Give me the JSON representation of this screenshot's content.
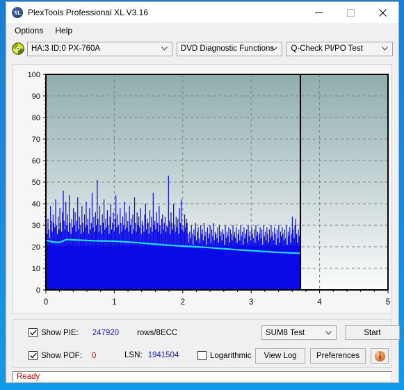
{
  "window": {
    "title": "PlexTools Professional XL V3.16",
    "icon_label": "XL",
    "minimize_label": "Minimize",
    "maximize_label": "Maximize",
    "close_label": "Close"
  },
  "menubar": {
    "items": [
      {
        "label": "Options"
      },
      {
        "label": "Help"
      }
    ]
  },
  "toolbar": {
    "drive": {
      "value": "HA:3 ID:0  PX-760A"
    },
    "function": {
      "value": "DVD Diagnostic Functions"
    },
    "test": {
      "value": "Q-Check PI/PO Test"
    }
  },
  "controls": {
    "show_pie": {
      "label": "Show PIE:",
      "checked": true,
      "value": "247920",
      "unit": "rows/8ECC"
    },
    "show_pof": {
      "label": "Show POF:",
      "checked": true,
      "value": "0"
    },
    "lsn": {
      "label": "LSN:",
      "value": "1941504"
    },
    "logarithmic": {
      "label": "Logarithmic",
      "checked": false
    },
    "test_select": {
      "value": "SUM8 Test"
    },
    "start_button": {
      "label": "Start"
    },
    "view_log_button": {
      "label": "View Log"
    },
    "preferences_button": {
      "label": "Preferences"
    },
    "info_button": {
      "label": "i"
    }
  },
  "statusbar": {
    "text": "Ready"
  },
  "chart_data": {
    "type": "area",
    "title": "",
    "xlabel": "",
    "ylabel": "",
    "xlim": [
      0,
      5
    ],
    "ylim": [
      0,
      100
    ],
    "xticks": [
      0,
      1,
      2,
      3,
      4,
      5
    ],
    "yticks": [
      0,
      10,
      20,
      30,
      40,
      50,
      60,
      70,
      80,
      90,
      100
    ],
    "grid": true,
    "legend": "none",
    "colors": {
      "pie_bars": "#0a0ae6",
      "average_line": "#1ce0f0",
      "plot_top": "#8fadae",
      "plot_bottom": "#fbfcfc",
      "axis": "#000000",
      "gridline": "#808080",
      "data_end_marker": "#000000"
    },
    "data_end_x": 3.72,
    "series": [
      {
        "name": "PIE",
        "type": "bar",
        "note": "Per-sample PI error peaks across the disc; dense spiky blue fill from x=0 to x=3.72",
        "x_start": 0,
        "x_end": 3.72,
        "n_samples": 300,
        "values": [
          30,
          26,
          33,
          28,
          24,
          39,
          32,
          27,
          35,
          31,
          29,
          42,
          30,
          26,
          34,
          28,
          38,
          31,
          27,
          36,
          46,
          32,
          28,
          41,
          30,
          35,
          27,
          44,
          31,
          26,
          33,
          29,
          38,
          30,
          36,
          27,
          32,
          43,
          28,
          34,
          30,
          26,
          39,
          31,
          27,
          35,
          29,
          41,
          30,
          33,
          26,
          38,
          28,
          31,
          45,
          29,
          34,
          27,
          36,
          30,
          51,
          33,
          27,
          39,
          30,
          26,
          35,
          31,
          42,
          28,
          33,
          29,
          37,
          30,
          26,
          34,
          40,
          28,
          31,
          36,
          27,
          33,
          44,
          29,
          35,
          30,
          26,
          38,
          31,
          27,
          34,
          30,
          41,
          28,
          36,
          29,
          32,
          27,
          39,
          30,
          33,
          26,
          35,
          28,
          43,
          31,
          27,
          36,
          30,
          34,
          29,
          38,
          26,
          32,
          30,
          27,
          35,
          40,
          28,
          33,
          31,
          26,
          37,
          29,
          34,
          27,
          45,
          30,
          32,
          28,
          36,
          31,
          27,
          39,
          30,
          26,
          33,
          35,
          28,
          31,
          34,
          27,
          30,
          29,
          53,
          32,
          26,
          36,
          31,
          28,
          40,
          30,
          27,
          34,
          29,
          33,
          26,
          38,
          31,
          42,
          28,
          30,
          27,
          35,
          29,
          33,
          31,
          26,
          22,
          27,
          24,
          30,
          26,
          21,
          28,
          25,
          31,
          23,
          27,
          29,
          24,
          22,
          30,
          26,
          28,
          23,
          31,
          25,
          27,
          21,
          29,
          24,
          26,
          30,
          22,
          28,
          25,
          31,
          23,
          27,
          26,
          24,
          29,
          22,
          30,
          25,
          27,
          23,
          28,
          26,
          21,
          30,
          24,
          27,
          25,
          29,
          22,
          28,
          26,
          23,
          30,
          25,
          27,
          24,
          29,
          22,
          26,
          28,
          23,
          30,
          25,
          27,
          21,
          29,
          24,
          26,
          28,
          22,
          30,
          25,
          27,
          23,
          29,
          26,
          24,
          28,
          22,
          30,
          25,
          27,
          23,
          26,
          29,
          24,
          28,
          21,
          30,
          25,
          27,
          23,
          29,
          26,
          22,
          28,
          24,
          30,
          25,
          27,
          23,
          29,
          26,
          21,
          28,
          24,
          30,
          22,
          27,
          25,
          29,
          26,
          23,
          28,
          24,
          30,
          21,
          27,
          25,
          29,
          22,
          26,
          34,
          28,
          24,
          30,
          33,
          26,
          22,
          28,
          25,
          31
        ]
      },
      {
        "name": "PIE average",
        "type": "line",
        "note": "Smooth cyan average line, starts near 23 and declines to about 17",
        "x_start": 0,
        "x_end": 3.72,
        "points": [
          [
            0.0,
            23.0
          ],
          [
            0.1,
            22.3
          ],
          [
            0.2,
            22.0
          ],
          [
            0.3,
            23.4
          ],
          [
            0.4,
            23.2
          ],
          [
            0.55,
            23.0
          ],
          [
            0.7,
            22.8
          ],
          [
            0.85,
            22.7
          ],
          [
            1.0,
            22.6
          ],
          [
            1.15,
            22.3
          ],
          [
            1.3,
            22.0
          ],
          [
            1.45,
            21.6
          ],
          [
            1.6,
            21.2
          ],
          [
            1.75,
            20.8
          ],
          [
            1.9,
            20.5
          ],
          [
            2.05,
            20.2
          ],
          [
            2.2,
            20.0
          ],
          [
            2.35,
            19.7
          ],
          [
            2.5,
            19.3
          ],
          [
            2.65,
            19.0
          ],
          [
            2.8,
            18.6
          ],
          [
            2.95,
            18.3
          ],
          [
            3.1,
            18.0
          ],
          [
            3.25,
            17.7
          ],
          [
            3.4,
            17.4
          ],
          [
            3.55,
            17.2
          ],
          [
            3.72,
            17.0
          ]
        ]
      },
      {
        "name": "POF",
        "type": "bar",
        "note": "All zero — no PO failures recorded",
        "values": []
      }
    ]
  }
}
